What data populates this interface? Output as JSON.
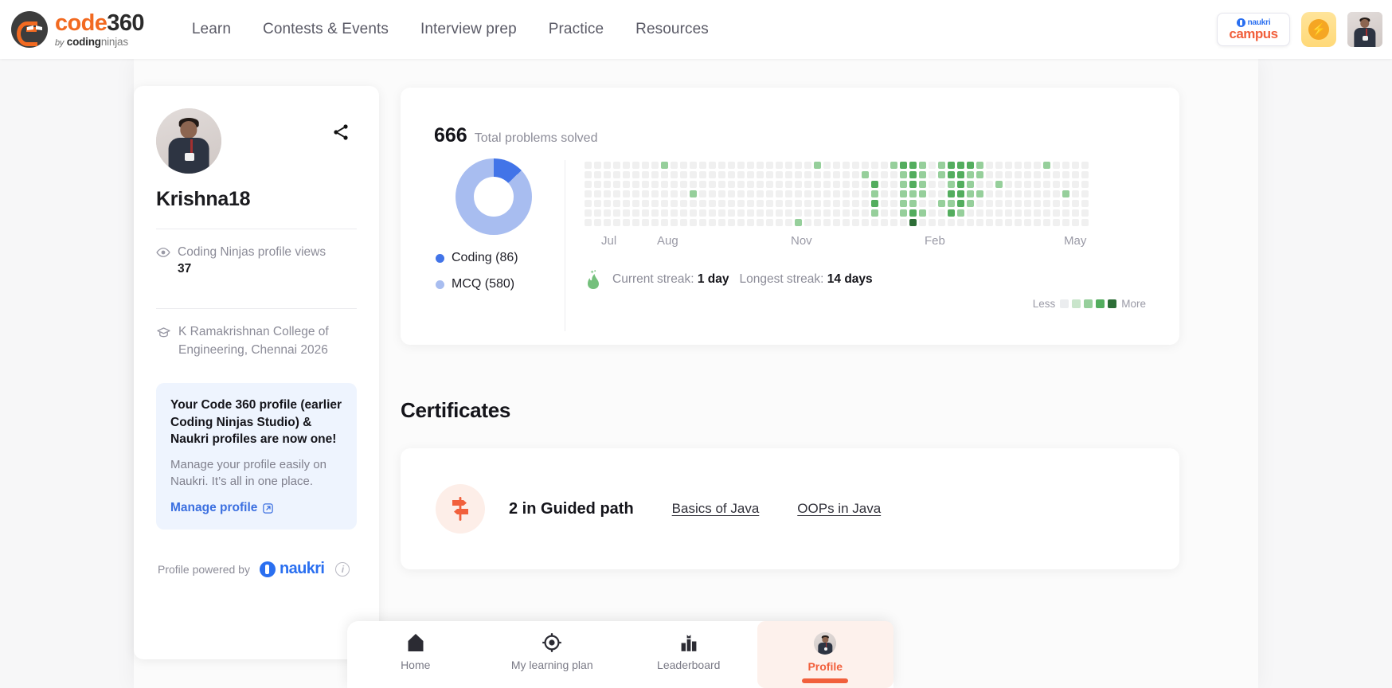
{
  "nav": {
    "logo": {
      "code": "code",
      "num": "360",
      "by": "by",
      "bold": "coding",
      "light": "ninjas"
    },
    "links": [
      "Learn",
      "Contests & Events",
      "Interview prep",
      "Practice",
      "Resources"
    ],
    "campus": {
      "naukri": "naukri",
      "word": "campus"
    },
    "bolt_icon": "bolt-icon",
    "avatar_icon": "user-avatar"
  },
  "sidebar": {
    "share_icon": "share-icon",
    "username": "Krishna18",
    "views_icon": "eye-icon",
    "views_label": "Coding Ninjas profile views",
    "views_count": "37",
    "college_icon": "graduation-cap-icon",
    "college": "K Ramakrishnan College of Engineering, Chennai 2026",
    "promo": {
      "title": "Your Code 360 profile (earlier Coding Ninjas Studio) & Naukri profiles are now one!",
      "body": "Manage your profile easily on Naukri. It’s all in one place.",
      "link": "Manage profile",
      "link_icon": "external-link-icon"
    },
    "powered_by": "Profile powered by",
    "naukri_word": "naukri",
    "info_icon": "info-icon"
  },
  "stats": {
    "total_number": "666",
    "total_label": "Total problems solved",
    "streak_icon": "flame-icon",
    "current_streak_label": "Current streak:",
    "current_streak_value": "1 day",
    "longest_streak_label": "Longest streak:",
    "longest_streak_value": "14 days",
    "scale_less": "Less",
    "scale_more": "More",
    "scale_colors": [
      "#ebedef",
      "#c9e5cb",
      "#96cf9b",
      "#53ad5e",
      "#2d6e37"
    ]
  },
  "chart_data": [
    {
      "type": "pie",
      "title": "Total problems solved",
      "total": 666,
      "categories": [
        "Coding (86)",
        "MCQ (580)"
      ],
      "values": [
        86,
        580
      ],
      "colors": [
        "#4274e8",
        "#a8bdf0"
      ],
      "legend": "bottom-left"
    },
    {
      "type": "heatmap",
      "title": "Contribution calendar",
      "xlabel": "",
      "ylabel": "",
      "months": [
        "Jul",
        "Aug",
        "Nov",
        "Feb",
        "May"
      ],
      "month_positions_pct": [
        3,
        13,
        37,
        61,
        86
      ],
      "rows": 7,
      "weeks": 53,
      "levels": [
        0,
        1,
        2,
        3,
        4
      ],
      "level_colors": [
        "#f0f0f0",
        "#c9e5cb",
        "#96cf9b",
        "#53ad5e",
        "#2d6e37"
      ],
      "legend": "Less → More",
      "cells": [
        [
          0,
          0,
          0,
          0,
          0,
          0,
          0
        ],
        [
          0,
          0,
          0,
          0,
          0,
          0,
          0
        ],
        [
          0,
          0,
          0,
          0,
          0,
          0,
          0
        ],
        [
          0,
          0,
          0,
          0,
          0,
          0,
          0
        ],
        [
          0,
          0,
          0,
          0,
          0,
          0,
          0
        ],
        [
          0,
          0,
          0,
          0,
          0,
          0,
          0
        ],
        [
          0,
          0,
          0,
          0,
          0,
          0,
          0
        ],
        [
          0,
          0,
          0,
          0,
          0,
          0,
          0
        ],
        [
          2,
          0,
          0,
          0,
          0,
          0,
          0
        ],
        [
          0,
          0,
          0,
          0,
          0,
          0,
          0
        ],
        [
          0,
          0,
          0,
          0,
          0,
          0,
          0
        ],
        [
          0,
          0,
          0,
          2,
          0,
          0,
          0
        ],
        [
          0,
          0,
          0,
          0,
          0,
          0,
          0
        ],
        [
          0,
          0,
          0,
          0,
          0,
          0,
          0
        ],
        [
          0,
          0,
          0,
          0,
          0,
          0,
          0
        ],
        [
          0,
          0,
          0,
          0,
          0,
          0,
          0
        ],
        [
          0,
          0,
          0,
          0,
          0,
          0,
          0
        ],
        [
          0,
          0,
          0,
          0,
          0,
          0,
          0
        ],
        [
          0,
          0,
          0,
          0,
          0,
          0,
          0
        ],
        [
          0,
          0,
          0,
          0,
          0,
          0,
          0
        ],
        [
          0,
          0,
          0,
          0,
          0,
          0,
          0
        ],
        [
          0,
          0,
          0,
          0,
          0,
          0,
          0
        ],
        [
          0,
          0,
          0,
          0,
          0,
          0,
          2
        ],
        [
          0,
          0,
          0,
          0,
          0,
          0,
          0
        ],
        [
          2,
          0,
          0,
          0,
          0,
          0,
          0
        ],
        [
          0,
          0,
          0,
          0,
          0,
          0,
          0
        ],
        [
          0,
          0,
          0,
          0,
          0,
          0,
          0
        ],
        [
          0,
          0,
          0,
          0,
          0,
          0,
          0
        ],
        [
          0,
          0,
          0,
          0,
          0,
          0,
          0
        ],
        [
          0,
          2,
          0,
          0,
          0,
          0,
          0
        ],
        [
          0,
          0,
          3,
          2,
          3,
          2,
          0
        ],
        [
          0,
          0,
          0,
          0,
          0,
          0,
          0
        ],
        [
          2,
          0,
          0,
          0,
          0,
          0,
          0
        ],
        [
          3,
          2,
          2,
          2,
          2,
          2,
          0
        ],
        [
          3,
          3,
          3,
          2,
          2,
          3,
          4
        ],
        [
          2,
          2,
          2,
          2,
          0,
          2,
          0
        ],
        [
          0,
          0,
          0,
          0,
          0,
          0,
          0
        ],
        [
          2,
          2,
          0,
          0,
          2,
          0,
          0
        ],
        [
          3,
          3,
          2,
          3,
          2,
          3,
          0
        ],
        [
          3,
          3,
          3,
          3,
          3,
          2,
          0
        ],
        [
          3,
          2,
          2,
          2,
          2,
          0,
          0
        ],
        [
          2,
          2,
          0,
          2,
          0,
          0,
          0
        ],
        [
          0,
          0,
          0,
          0,
          0,
          0,
          0
        ],
        [
          0,
          0,
          2,
          0,
          0,
          0,
          0
        ],
        [
          0,
          0,
          0,
          0,
          0,
          0,
          0
        ],
        [
          0,
          0,
          0,
          0,
          0,
          0,
          0
        ],
        [
          0,
          0,
          0,
          0,
          0,
          0,
          0
        ],
        [
          0,
          0,
          0,
          0,
          0,
          0,
          0
        ],
        [
          2,
          0,
          0,
          0,
          0,
          0,
          0
        ],
        [
          0,
          0,
          0,
          0,
          0,
          0,
          0
        ],
        [
          0,
          0,
          0,
          2,
          0,
          0,
          0
        ],
        [
          0,
          0,
          0,
          0,
          0,
          0,
          0
        ],
        [
          0,
          0,
          0,
          0,
          0,
          0,
          0
        ]
      ]
    }
  ],
  "certificates": {
    "heading": "Certificates",
    "icon": "signpost-icon",
    "count_label": "2 in Guided path",
    "links": [
      "Basics of Java",
      "OOPs in Java"
    ]
  },
  "bottom_nav": {
    "items": [
      {
        "label": "Home",
        "icon": "home-icon",
        "active": false
      },
      {
        "label": "My learning plan",
        "icon": "target-icon",
        "active": false
      },
      {
        "label": "Leaderboard",
        "icon": "podium-icon",
        "active": false
      },
      {
        "label": "Profile",
        "icon": "avatar-icon",
        "active": true
      }
    ]
  }
}
